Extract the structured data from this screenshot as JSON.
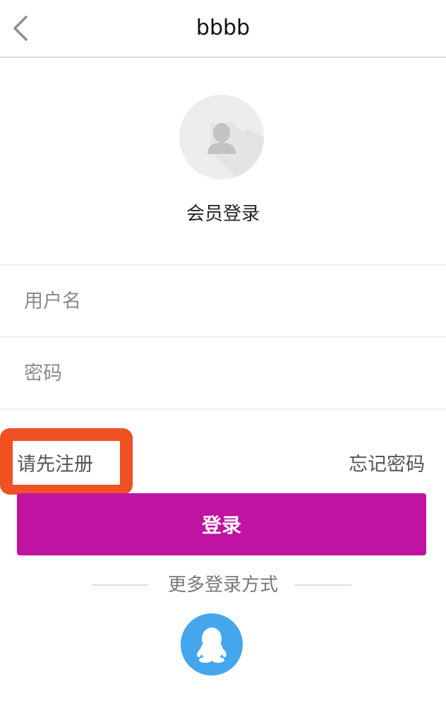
{
  "header": {
    "title": "bbbb",
    "back_icon": "chevron-left-icon"
  },
  "profile": {
    "avatar_icon": "user-silhouette-icon",
    "subtitle": "会员登录"
  },
  "form": {
    "username_placeholder": "用户名",
    "username_value": "",
    "password_placeholder": "密码",
    "password_value": ""
  },
  "links": {
    "register": "请先注册",
    "forgot": "忘记密码"
  },
  "login_button": {
    "label": "登录",
    "color": "#c013a1"
  },
  "more_login": {
    "label": "更多登录方式",
    "qq_icon": "qq-penguin-icon",
    "qq_color": "#45a6ee"
  },
  "highlight": {
    "color": "#ef5122"
  }
}
